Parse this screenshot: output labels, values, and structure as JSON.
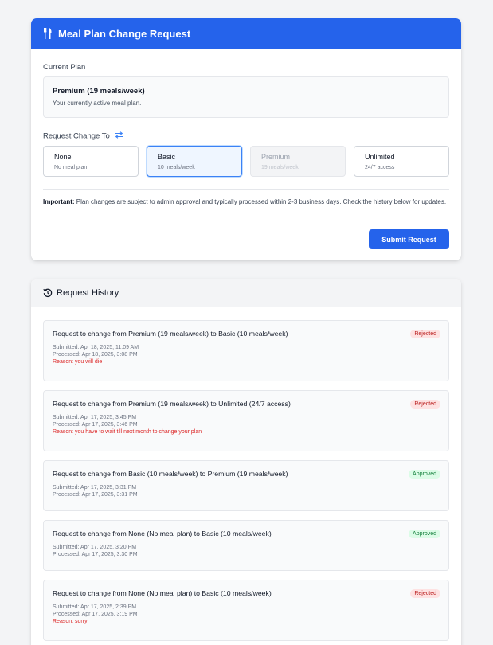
{
  "main": {
    "title": "Meal Plan Change Request",
    "current_label": "Current Plan",
    "current_plan": "Premium (19 meals/week)",
    "current_note": "Your currently active meal plan.",
    "request_label": "Request Change To",
    "options": [
      {
        "name": "None",
        "desc": "No meal plan"
      },
      {
        "name": "Basic",
        "desc": "10 meals/week"
      },
      {
        "name": "Premium",
        "desc": "19 meals/week"
      },
      {
        "name": "Unlimited",
        "desc": "24/7 access"
      }
    ],
    "important_label": "Important:",
    "important_text": "Plan changes are subject to admin approval and typically processed within 2-3 business days. Check the history below for updates.",
    "submit_label": "Submit Request"
  },
  "history": {
    "title": "Request History",
    "items": [
      {
        "title": "Request to change from Premium (19 meals/week) to Basic (10 meals/week)",
        "status": "Rejected",
        "submitted": "Submitted: Apr 18, 2025, 11:09 AM",
        "processed": "Processed: Apr 18, 2025, 3:08 PM",
        "reason": "Reason: you will die"
      },
      {
        "title": "Request to change from Premium (19 meals/week) to Unlimited (24/7 access)",
        "status": "Rejected",
        "submitted": "Submitted: Apr 17, 2025, 3:45 PM",
        "processed": "Processed: Apr 17, 2025, 3:46 PM",
        "reason": "Reason: you have to wait till next month to change your plan"
      },
      {
        "title": "Request to change from Basic (10 meals/week) to Premium (19 meals/week)",
        "status": "Approved",
        "submitted": "Submitted: Apr 17, 2025, 3:31 PM",
        "processed": "Processed: Apr 17, 2025, 3:31 PM",
        "reason": ""
      },
      {
        "title": "Request to change from None (No meal plan) to Basic (10 meals/week)",
        "status": "Approved",
        "submitted": "Submitted: Apr 17, 2025, 3:20 PM",
        "processed": "Processed: Apr 17, 2025, 3:30 PM",
        "reason": ""
      },
      {
        "title": "Request to change from None (No meal plan) to Basic (10 meals/week)",
        "status": "Rejected",
        "submitted": "Submitted: Apr 17, 2025, 2:39 PM",
        "processed": "Processed: Apr 17, 2025, 3:19 PM",
        "reason": "Reason: sorry"
      }
    ]
  },
  "colors": {
    "primary": "#2563eb",
    "rejected": "#b91c1c",
    "approved": "#15803d"
  },
  "icons": {
    "header": "utensils-icon",
    "swap": "swap-arrows-icon",
    "history": "history-icon"
  }
}
